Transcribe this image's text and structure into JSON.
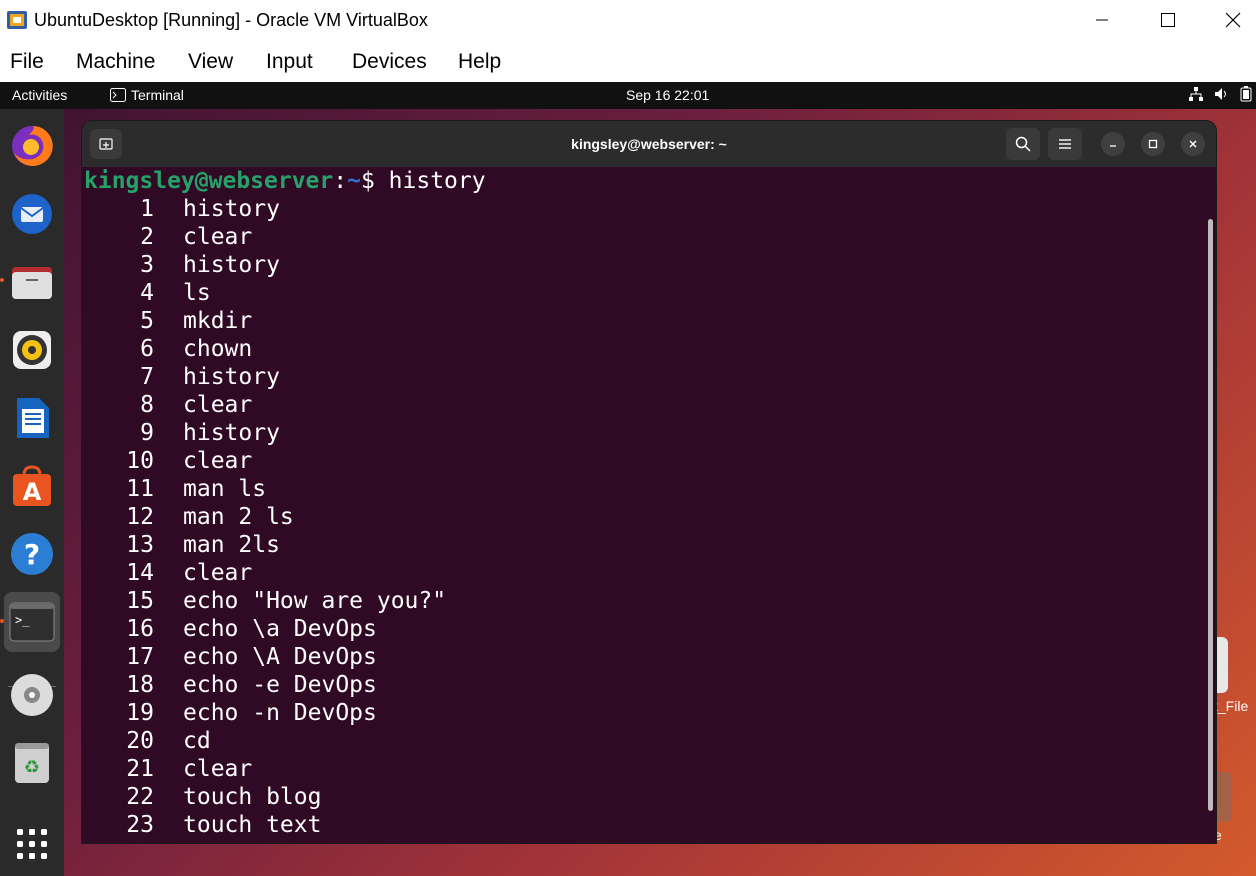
{
  "vbox": {
    "title": "UbuntuDesktop [Running] - Oracle VM VirtualBox",
    "menu": [
      "File",
      "Machine",
      "View",
      "Input",
      "Devices",
      "Help"
    ]
  },
  "topbar": {
    "activities": "Activities",
    "app_name": "Terminal",
    "clock": "Sep 16  22:01"
  },
  "dock": {
    "items": [
      "firefox-icon",
      "thunderbird-icon",
      "files-icon",
      "rhythmbox-icon",
      "writer-icon",
      "app-center-icon",
      "help-icon",
      "terminal-icon",
      "dvd-icon",
      "trash-icon",
      "show-apps-icon"
    ]
  },
  "desktop": {
    "file_label": "t_File",
    "file2_label": "e"
  },
  "terminal": {
    "title": "kingsley@webserver: ~",
    "prompt_user": "kingsley@webserver",
    "prompt_path": "~",
    "prompt_symbol": "$ ",
    "command": "history",
    "history": [
      {
        "n": "1",
        "cmd": "history"
      },
      {
        "n": "2",
        "cmd": "clear"
      },
      {
        "n": "3",
        "cmd": "history"
      },
      {
        "n": "4",
        "cmd": "ls"
      },
      {
        "n": "5",
        "cmd": "mkdir"
      },
      {
        "n": "6",
        "cmd": "chown"
      },
      {
        "n": "7",
        "cmd": "history"
      },
      {
        "n": "8",
        "cmd": "clear"
      },
      {
        "n": "9",
        "cmd": "history"
      },
      {
        "n": "10",
        "cmd": "clear"
      },
      {
        "n": "11",
        "cmd": "man ls"
      },
      {
        "n": "12",
        "cmd": "man 2 ls"
      },
      {
        "n": "13",
        "cmd": "man 2ls"
      },
      {
        "n": "14",
        "cmd": "clear"
      },
      {
        "n": "15",
        "cmd": "echo \"How are you?\""
      },
      {
        "n": "16",
        "cmd": "echo \\a DevOps"
      },
      {
        "n": "17",
        "cmd": "echo \\A DevOps"
      },
      {
        "n": "18",
        "cmd": "echo -e DevOps"
      },
      {
        "n": "19",
        "cmd": "echo -n DevOps"
      },
      {
        "n": "20",
        "cmd": "cd"
      },
      {
        "n": "21",
        "cmd": "clear"
      },
      {
        "n": "22",
        "cmd": "touch blog"
      },
      {
        "n": "23",
        "cmd": "touch text"
      }
    ]
  }
}
